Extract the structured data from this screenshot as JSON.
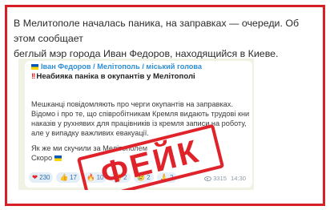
{
  "article": {
    "line1": "В Мелитополе началась паника, на заправках — очереди. Об этом сообщает",
    "line2": "беглый мэр города Иван Федоров, находящийся в Киеве."
  },
  "telegram_post": {
    "channel": "Іван Федоров / Мелітополь / міський голова",
    "headline_marks": "!!",
    "headline": "Неабияка паніка в окупантів у Мелітополі",
    "body_lines": [
      "Мешканці повідомляють про черги окупантів на заправках.",
      "Відомо і про те, що співробітникам Кремля видають трудові книжки. Із",
      "наказів у рухнявих для працівників із кремля записи на роботу,",
      "але у випадку важливих евакуації."
    ],
    "closing_line1": "Як же ми скучили за Мелітополем",
    "closing_line2": "Скоро",
    "reactions": [
      {
        "emoji": "❤",
        "count": "230"
      },
      {
        "emoji": "👍",
        "count": "17"
      },
      {
        "emoji": "🔥",
        "count": "10"
      },
      {
        "emoji": "😁",
        "count": "2"
      },
      {
        "emoji": "😢",
        "count": "2"
      },
      {
        "emoji": "🙏",
        "count": "2"
      }
    ],
    "views": "3315",
    "time": "14:30"
  },
  "stamp": {
    "label": "ФЕЙК",
    "color": "#e0232b"
  },
  "colors": {
    "frame_border": "#d61f26",
    "channel_name": "#2e8fd6"
  }
}
